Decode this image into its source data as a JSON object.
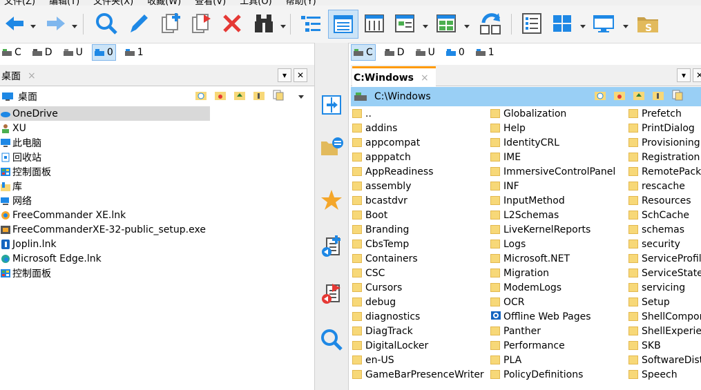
{
  "menu": [
    "文件(Z)",
    "编辑(T)",
    "文件夹(X)",
    "收藏(W)",
    "查看(V)",
    "工具(O)",
    "帮助(Y)"
  ],
  "toolbar_icons": [
    "back-arrow-icon",
    "forward-arrow-icon",
    "search-icon",
    "edit-pen-icon",
    "new-file-icon",
    "copy-file-icon",
    "delete-x-icon",
    "binoculars-icon",
    "tree-view-icon",
    "details-view-icon",
    "list-view-icon",
    "thumbnail-view-icon",
    "split-view-icon",
    "sync-icon",
    "checklist-icon",
    "layout-grid-icon",
    "monitor-icon",
    "file-s-icon"
  ],
  "left": {
    "drives": [
      {
        "letter": "C"
      },
      {
        "letter": "D"
      },
      {
        "letter": "U"
      },
      {
        "letter": "0",
        "selected": true
      },
      {
        "letter": "1"
      }
    ],
    "tab": {
      "label": "桌面",
      "close": "×"
    },
    "path": "桌面",
    "items": [
      {
        "name": "OneDrive",
        "icon": "cloud-icon",
        "selected": true
      },
      {
        "name": "XU",
        "icon": "user-icon"
      },
      {
        "name": "此电脑",
        "icon": "computer-icon"
      },
      {
        "name": "回收站",
        "icon": "recycle-bin-icon"
      },
      {
        "name": "控制面板",
        "icon": "control-panel-icon"
      },
      {
        "name": "库",
        "icon": "library-icon"
      },
      {
        "name": "网络",
        "icon": "network-icon"
      },
      {
        "name": "FreeCommander XE.lnk",
        "icon": "app-shortcut-icon"
      },
      {
        "name": "FreeCommanderXE-32-public_setup.exe",
        "icon": "installer-icon"
      },
      {
        "name": "Joplin.lnk",
        "icon": "joplin-icon"
      },
      {
        "name": "Microsoft Edge.lnk",
        "icon": "edge-icon"
      },
      {
        "name": "控制面板",
        "icon": "control-panel-icon"
      }
    ]
  },
  "right": {
    "drives": [
      {
        "letter": "C",
        "selected": true
      },
      {
        "letter": "D"
      },
      {
        "letter": "U"
      },
      {
        "letter": "0"
      },
      {
        "letter": "1"
      }
    ],
    "tab": {
      "label": "C:Windows",
      "close": "×"
    },
    "path": "C:\\Windows",
    "col1": [
      "..",
      "addins",
      "appcompat",
      "apppatch",
      "AppReadiness",
      "assembly",
      "bcastdvr",
      "Boot",
      "Branding",
      "CbsTemp",
      "Containers",
      "CSC",
      "Cursors",
      "debug",
      "diagnostics",
      "DiagTrack",
      "DigitalLocker",
      "en-US",
      "GameBarPresenceWriter"
    ],
    "col2": [
      "Globalization",
      "Help",
      "IdentityCRL",
      "IME",
      "ImmersiveControlPanel",
      "INF",
      "InputMethod",
      "L2Schemas",
      "LiveKernelReports",
      "Logs",
      "Microsoft.NET",
      "Migration",
      "ModemLogs",
      "OCR",
      "Offline Web Pages",
      "Panther",
      "Performance",
      "PLA",
      "PolicyDefinitions"
    ],
    "col3": [
      "Prefetch",
      "PrintDialog",
      "Provisioning",
      "Registration",
      "RemotePacka",
      "rescache",
      "Resources",
      "SchCache",
      "schemas",
      "security",
      "ServiceProfile",
      "ServiceState",
      "servicing",
      "Setup",
      "ShellCompon",
      "ShellExperien",
      "SKB",
      "SoftwareDist",
      "Speech"
    ]
  },
  "tab_buttons": {
    "dropdown": "▾",
    "close": "✕"
  },
  "colors": {
    "accent": "#1e88e5",
    "folder": "#f7d878",
    "path_bg": "#99cff5",
    "tab_accent": "#ff9a00"
  }
}
